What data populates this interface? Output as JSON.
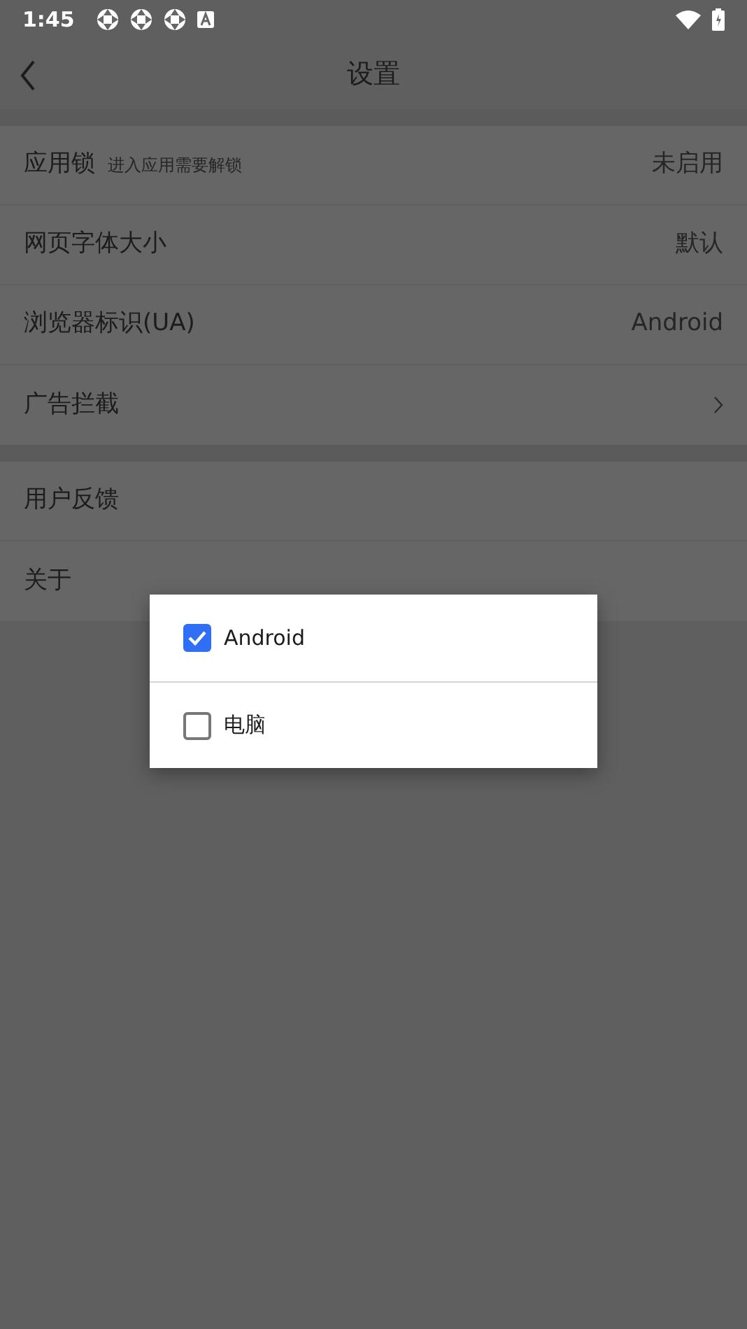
{
  "status_bar": {
    "time": "1:45"
  },
  "header": {
    "title": "设置"
  },
  "sections": [
    {
      "items": [
        {
          "kind": "value",
          "label": "应用锁",
          "subtitle": "进入应用需要解锁",
          "value": "未启用"
        },
        {
          "kind": "value",
          "label": "网页字体大小",
          "value": "默认"
        },
        {
          "kind": "value",
          "label": "浏览器标识(UA)",
          "value": "Android"
        },
        {
          "kind": "arrow",
          "label": "广告拦截"
        }
      ]
    },
    {
      "items": [
        {
          "kind": "plain",
          "label": "用户反馈"
        },
        {
          "kind": "plain",
          "label": "关于"
        }
      ]
    }
  ],
  "dialog": {
    "options": [
      {
        "label": "Android",
        "checked": true
      },
      {
        "label": "电脑",
        "checked": false
      }
    ]
  }
}
